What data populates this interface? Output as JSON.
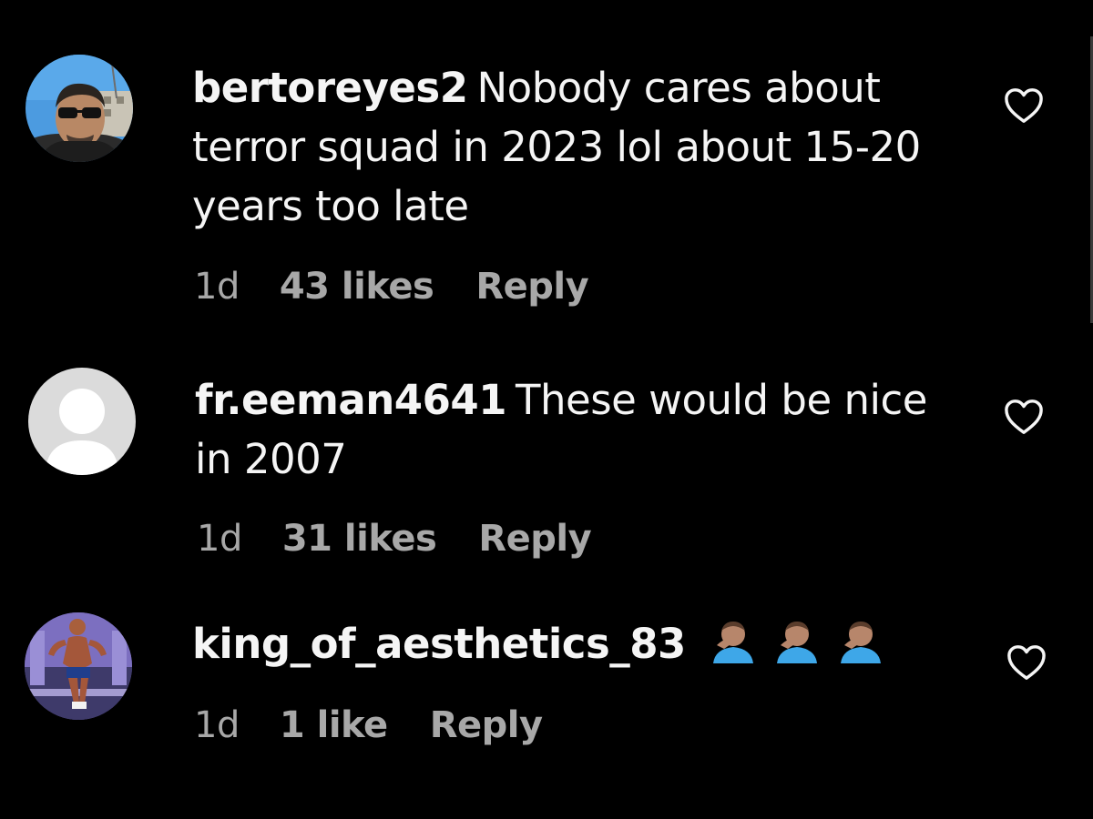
{
  "comments": [
    {
      "username": "bertoreyes2",
      "text": "Nobody cares about terror squad in 2023 lol about 15-20 years too late",
      "time": "1d",
      "likes": "43 likes",
      "reply": "Reply",
      "avatar": "profile-photo-man-sunglasses",
      "liked": false
    },
    {
      "username": "fr.eeman4641",
      "text": "These would be nice in 2007",
      "time": "1d",
      "likes": "31 likes",
      "reply": "Reply",
      "avatar": "default-avatar",
      "liked": false
    },
    {
      "username": "king_of_aesthetics_83",
      "text": "",
      "emoji": [
        "man-facepalming-medium-skin-tone",
        "man-facepalming-medium-skin-tone",
        "man-facepalming-medium-skin-tone"
      ],
      "time": "1d",
      "likes": "1 like",
      "reply": "Reply",
      "avatar": "profile-photo-bodybuilder",
      "liked": false
    }
  ],
  "icons": {
    "like": "heart-outline-icon"
  },
  "colors": {
    "background": "#000000",
    "text": "#f5f5f5",
    "meta": "#a8a8a8",
    "default_avatar_bg": "#dbdbdb",
    "emoji_shirt": "#3ea7e8",
    "emoji_skin": "#b7866b"
  }
}
